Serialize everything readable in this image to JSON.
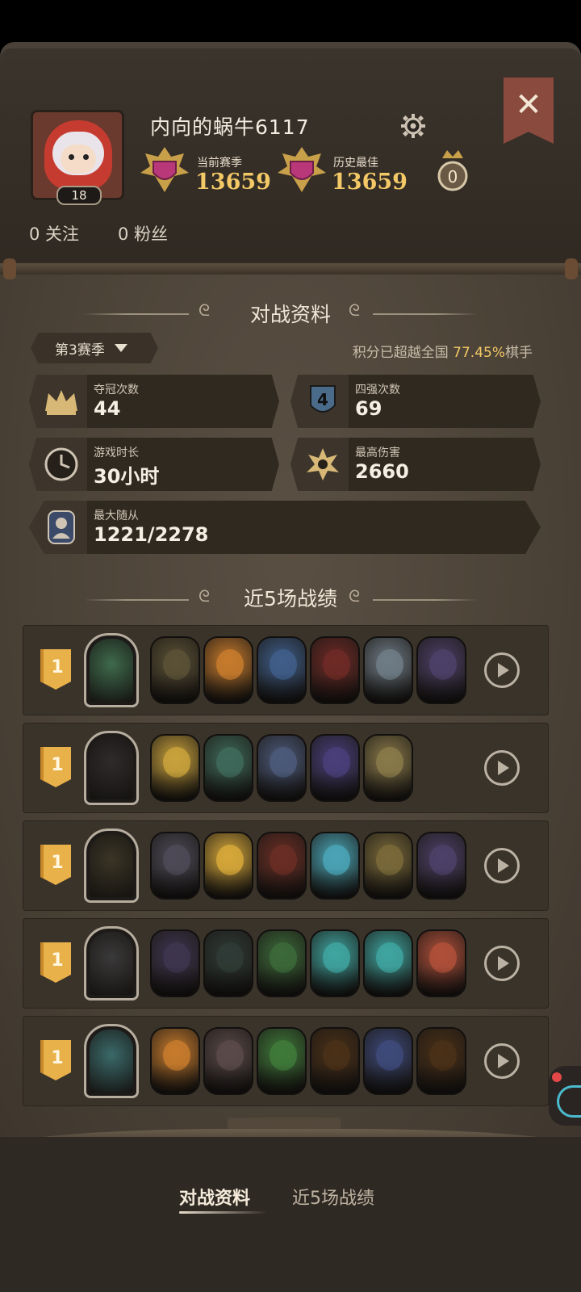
{
  "header": {
    "username": "内向的蜗牛6117",
    "level": "18",
    "current_season_label": "当前赛季",
    "current_season_score": "13659",
    "best_label": "历史最佳",
    "best_score": "13659",
    "crown_count": "0",
    "follow_text": "0 关注",
    "fans_text": "0 粉丝"
  },
  "battle_section": {
    "title": "对战资料",
    "season": "第3赛季",
    "rank_prefix": "积分已超越全国 ",
    "rank_pct": "77.45%",
    "rank_suffix": "棋手"
  },
  "stats": {
    "champion": {
      "label": "夺冠次数",
      "value": "44"
    },
    "top4": {
      "label": "四强次数",
      "value": "69"
    },
    "playtime": {
      "label": "游戏时长",
      "value": "30小时"
    },
    "max_damage": {
      "label": "最高伤害",
      "value": "2660"
    },
    "max_minion": {
      "label": "最大随从",
      "value": "1221/2278"
    }
  },
  "recent_section": {
    "title": "近5场战绩"
  },
  "matches": [
    {
      "place": "1",
      "hero": "#3f6a4c",
      "units": [
        "#5b5136",
        "#c77b2d",
        "#3f5e8a",
        "#6e2a26",
        "#6f7c86",
        "#4d4168"
      ]
    },
    {
      "place": "1",
      "hero": "#2e2b2a",
      "units": [
        "#c9a23c",
        "#3e6a5a",
        "#4c5a7a",
        "#4a3f7a",
        "#8a7a4a"
      ]
    },
    {
      "place": "1",
      "hero": "#3a3526",
      "units": [
        "#4d4a57",
        "#d6a83a",
        "#6a2e25",
        "#4aa5b6",
        "#7a6a3a",
        "#4d4168"
      ]
    },
    {
      "place": "1",
      "hero": "#3b3a3a",
      "units": [
        "#3e3550",
        "#2f3b36",
        "#3c6a3a",
        "#3fa5a0",
        "#3fa5a0",
        "#b0503a"
      ]
    },
    {
      "place": "1",
      "hero": "#3b6a6a",
      "units": [
        "#c77b2d",
        "#5a4a4a",
        "#3f7a3a",
        "#4a3018",
        "#3e4a7a",
        "#4a3018"
      ]
    }
  ],
  "bottom_nav": {
    "tab_battle": "对战资料",
    "tab_recent": "近5场战绩"
  },
  "colors": {
    "accent_gold": "#f3c866",
    "close_red": "#8a4a3e",
    "place_gold": "#e8b14a"
  }
}
